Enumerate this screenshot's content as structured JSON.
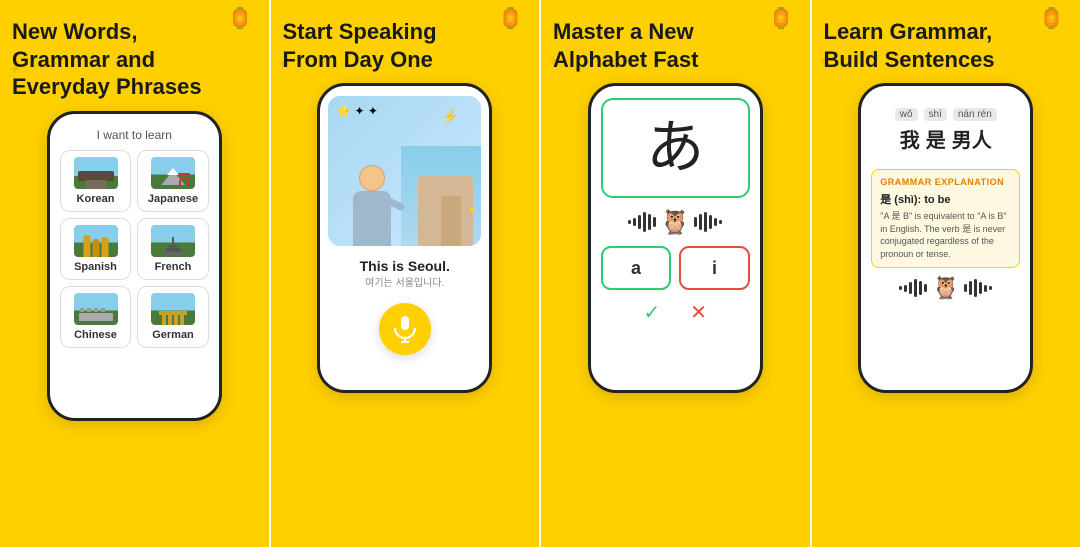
{
  "panels": [
    {
      "id": "panel1",
      "title": "New Words,\nGrammar and\nEveryday Phrases",
      "learn_label": "I want to learn",
      "languages": [
        {
          "name": "Korean",
          "row": 0,
          "col": 0
        },
        {
          "name": "Japanese",
          "row": 0,
          "col": 1
        },
        {
          "name": "Spanish",
          "row": 1,
          "col": 0
        },
        {
          "name": "French",
          "row": 1,
          "col": 1
        },
        {
          "name": "Chinese",
          "row": 2,
          "col": 0
        },
        {
          "name": "German",
          "row": 2,
          "col": 1
        }
      ]
    },
    {
      "id": "panel2",
      "title": "Start Speaking\nFrom Day One",
      "main_text": "This is Seoul.",
      "sub_text": "여기는 서울입니다."
    },
    {
      "id": "panel3",
      "title": "Master a New\nAlphabet Fast",
      "hiragana": "あ",
      "answer_a": "a",
      "answer_i": "i"
    },
    {
      "id": "panel4",
      "title": "Learn Grammar,\nBuild Sentences",
      "pinyin": [
        "wǒ",
        "shì",
        "nán rén"
      ],
      "chinese_chars": [
        "我",
        "是",
        "男人"
      ],
      "grammar_title": "Grammar Explanation",
      "grammar_main": "是 (shì): to be",
      "grammar_desc": "\"A 是 B\" is equivalent to \"A is B\" in English. The verb 是 is never conjugated regardless of the pronoun or tense."
    }
  ],
  "colors": {
    "background": "#FFD000",
    "panel_border": "#ffffff",
    "text_dark": "#1a1a1a",
    "correct": "#2ecc71",
    "incorrect": "#e74c3c",
    "grammar_bg": "#fff8e1",
    "grammar_border": "#FFD000",
    "grammar_accent": "#e67e00"
  }
}
